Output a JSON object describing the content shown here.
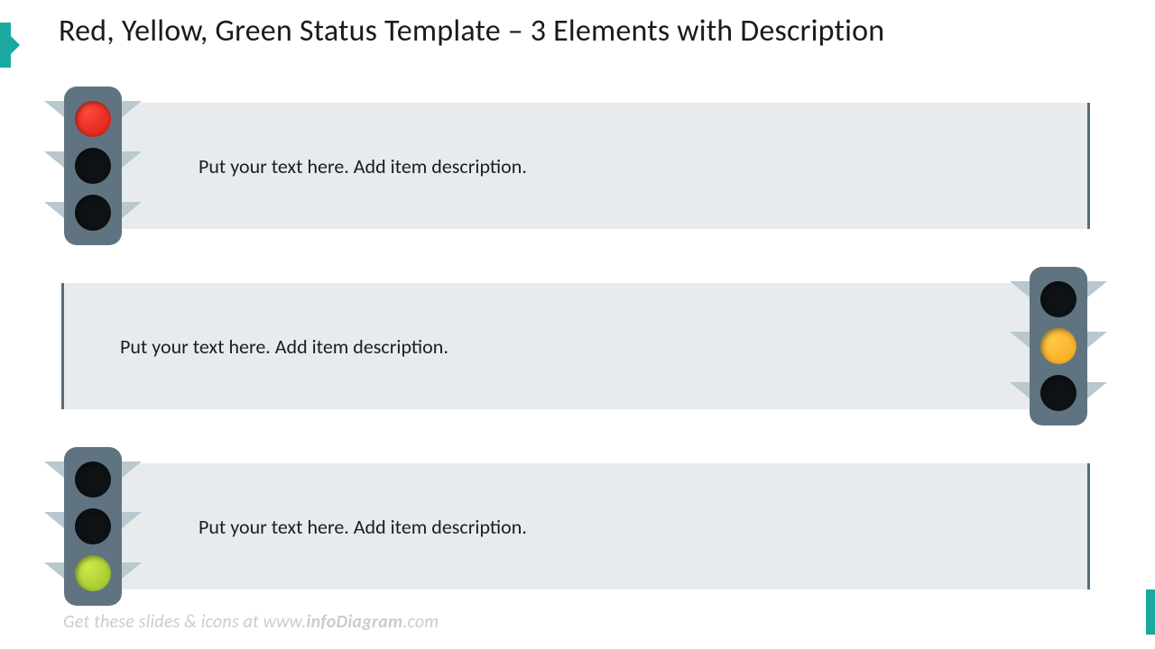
{
  "title": "Red, Yellow, Green Status Template – 3 Elements with Description",
  "rows": [
    {
      "text": "Put your text here. Add item description.",
      "lit": "red",
      "side": "left"
    },
    {
      "text": "Put your text here. Add item description.",
      "lit": "yellow",
      "side": "right"
    },
    {
      "text": "Put your text here. Add item description.",
      "lit": "green",
      "side": "left"
    }
  ],
  "footer": {
    "prefix": "Get these slides & icons at www.",
    "bold": "infoDiagram",
    "suffix": ".com"
  },
  "colors": {
    "accent": "#1aa9a0",
    "barBg": "#e7ebee",
    "tlBody": "#5f7380",
    "barBorder": "#5a6b78"
  }
}
